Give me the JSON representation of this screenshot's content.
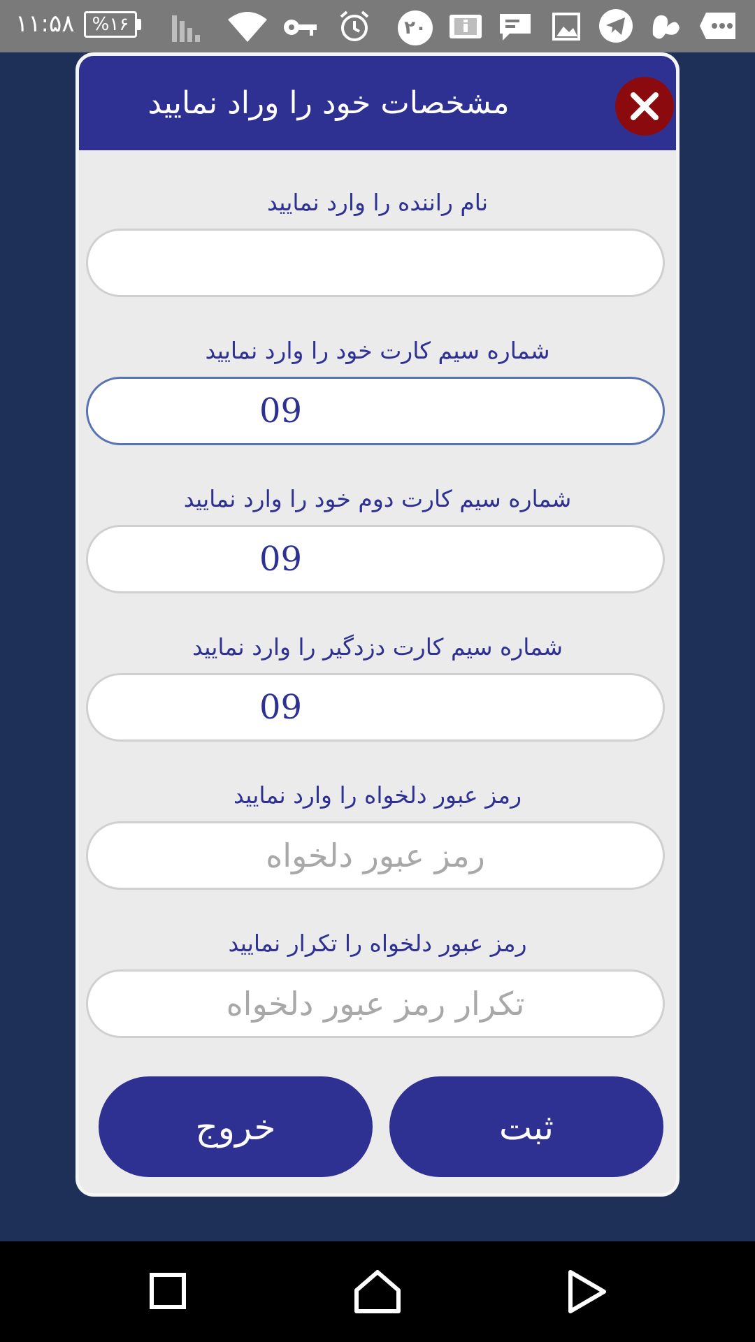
{
  "status_bar": {
    "time": "۱۱:۵۸",
    "battery": "%۱۶",
    "notification_count": "۲۰",
    "icons": [
      "signal-icon",
      "wifi-icon",
      "key-icon",
      "alarm-icon",
      "notification-count-icon",
      "info-icon",
      "message-icon",
      "image-icon",
      "telegram-icon",
      "app-logo-icon",
      "more-icon"
    ]
  },
  "dialog": {
    "title": "مشخصات خود را وراد نمایید",
    "fields": [
      {
        "label": "نام راننده را وارد نمایید",
        "value": "",
        "placeholder": ""
      },
      {
        "label": "شماره سیم کارت خود را وارد نمایید",
        "value": "09",
        "placeholder": ""
      },
      {
        "label": "شماره سیم کارت دوم خود را وارد نمایید",
        "value": "09",
        "placeholder": ""
      },
      {
        "label": "شماره سیم کارت دزدگیر را وارد نمایید",
        "value": "09",
        "placeholder": ""
      },
      {
        "label": "رمز عبور دلخواه را وارد نمایید",
        "value": "",
        "placeholder": "رمز عبور دلخواه"
      },
      {
        "label": "رمز عبور دلخواه را تکرار نمایید",
        "value": "",
        "placeholder": "تکرار رمز عبور دلخواه"
      }
    ],
    "buttons": {
      "submit": "ثبت",
      "exit": "خروج"
    }
  },
  "colors": {
    "background": "#1e3058",
    "header": "#2e3192",
    "close": "#8b0a0e",
    "status_bar": "#7a7a7a"
  },
  "nav_bar": {
    "icons": [
      "recents-icon",
      "home-icon",
      "back-icon"
    ]
  }
}
